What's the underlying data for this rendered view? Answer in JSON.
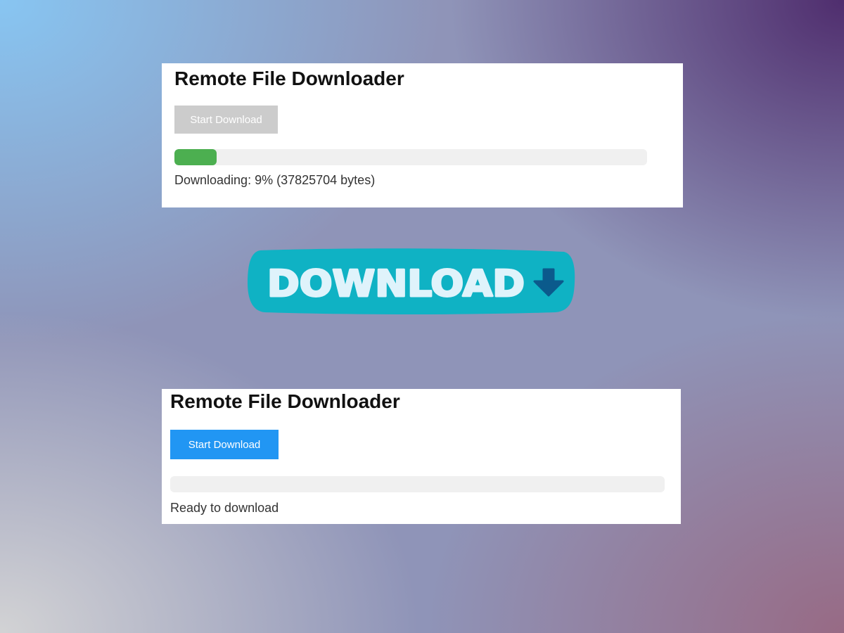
{
  "panels": {
    "downloading": {
      "title": "Remote File Downloader",
      "button_label": "Start Download",
      "button_state": "disabled",
      "progress_percent": 9,
      "status": "Downloading: 9% (37825704 bytes)"
    },
    "ready": {
      "title": "Remote File Downloader",
      "button_label": "Start Download",
      "button_state": "enabled",
      "progress_percent": 0,
      "status": "Ready to download"
    }
  },
  "badge": {
    "text": "DOWNLOAD",
    "icon": "down-arrow-icon"
  },
  "colors": {
    "button_disabled": "#cccccc",
    "button_enabled": "#2196f3",
    "progress_fill": "#4caf50",
    "progress_track": "#f0f0f0",
    "badge_background": "#0fb2c4",
    "badge_text": "#dff3fb",
    "badge_arrow": "#0b5a8c"
  }
}
